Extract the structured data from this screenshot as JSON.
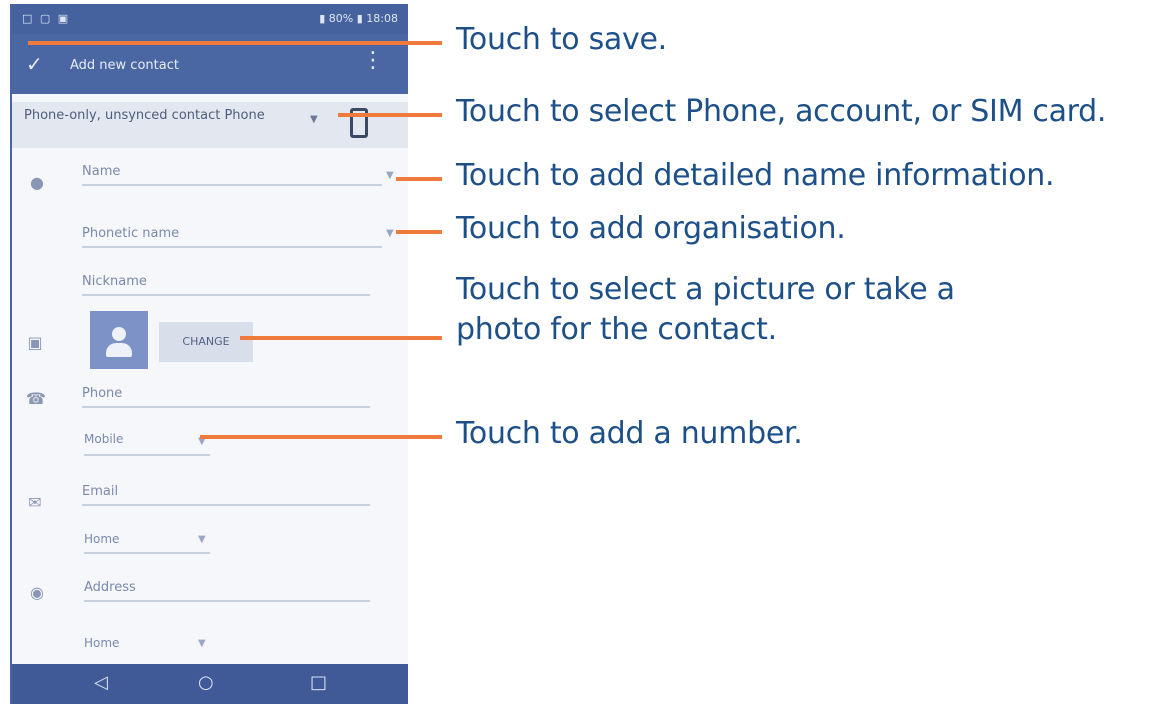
{
  "phone": {
    "statusbar": {
      "left": "□ ▢ ▣",
      "right": "▮ 80% ▮ 18:08"
    },
    "appbar": {
      "title": "Add new contact",
      "check_icon": "check-icon",
      "menu_icon": "overflow-menu-icon"
    },
    "account": {
      "text": "Phone-only, unsynced contact Phone"
    },
    "fields": {
      "name": "Name",
      "phonetic_name": "Phonetic name",
      "nickname": "Nickname",
      "photo_change": "CHANGE",
      "phone": "Phone",
      "phone_type": "Mobile",
      "email": "Email",
      "email_type": "Home",
      "address": "Address",
      "address_type": "Home"
    },
    "nav": {
      "back": "back-icon",
      "home": "home-icon",
      "recent": "recent-apps-icon"
    }
  },
  "callouts": {
    "save": "Touch to save.",
    "account": "Touch to select Phone, account, or SIM card.",
    "name": "Touch to add detailed name information.",
    "organisation": "Touch to add organisation.",
    "picture_line1": "Touch to select a picture or take a",
    "picture_line2": "photo for the contact.",
    "number": "Touch to add a number."
  },
  "colors": {
    "accent": "#f07a3c",
    "callout_text": "#1d4f88",
    "appbar": "#4b67a3"
  }
}
